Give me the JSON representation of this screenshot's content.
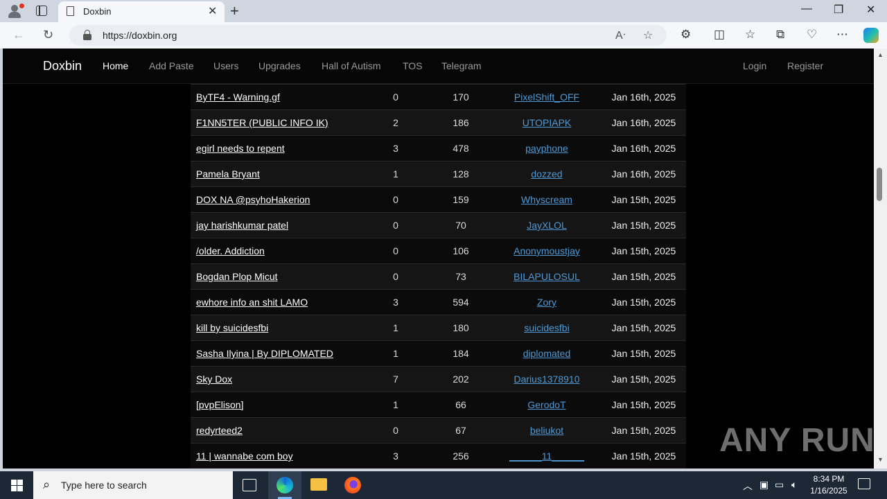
{
  "browser": {
    "tab_title": "Doxbin",
    "url": "https://doxbin.org"
  },
  "site": {
    "brand": "Doxbin",
    "nav": [
      "Home",
      "Add Paste",
      "Users",
      "Upgrades",
      "Hall of Autism",
      "TOS",
      "Telegram"
    ],
    "login": "Login",
    "register": "Register"
  },
  "pastes": [
    {
      "title": "ByTF4 - Warning.gf",
      "comments": "0",
      "views": "170",
      "user": "PixelShift_OFF",
      "date": "Jan 16th, 2025"
    },
    {
      "title": "F1NN5TER (PUBLIC INFO IK)",
      "comments": "2",
      "views": "186",
      "user": "UTOPIAPK",
      "date": "Jan 16th, 2025"
    },
    {
      "title": "egirl needs to repent",
      "comments": "3",
      "views": "478",
      "user": "payphone",
      "date": "Jan 16th, 2025"
    },
    {
      "title": "Pamela Bryant",
      "comments": "1",
      "views": "128",
      "user": "dozzed",
      "date": "Jan 16th, 2025"
    },
    {
      "title": "DOX NA @psyhoHakerion",
      "comments": "0",
      "views": "159",
      "user": "Whyscream",
      "date": "Jan 15th, 2025"
    },
    {
      "title": "jay harishkumar patel",
      "comments": "0",
      "views": "70",
      "user": "JayXLOL",
      "date": "Jan 15th, 2025"
    },
    {
      "title": "/older. Addiction",
      "comments": "0",
      "views": "106",
      "user": "Anonymoustjay",
      "date": "Jan 15th, 2025"
    },
    {
      "title": "Bogdan Plop Micut",
      "comments": "0",
      "views": "73",
      "user": "BILAPULOSUL",
      "date": "Jan 15th, 2025"
    },
    {
      "title": "ewhore info an shit LAMO",
      "comments": "3",
      "views": "594",
      "user": "Zory",
      "date": "Jan 15th, 2025"
    },
    {
      "title": "kill by suicidesfbi",
      "comments": "1",
      "views": "180",
      "user": "suicidesfbi",
      "date": "Jan 15th, 2025"
    },
    {
      "title": "Sasha Ilyina | By DIPLOMATED",
      "comments": "1",
      "views": "184",
      "user": "diplomated",
      "date": "Jan 15th, 2025"
    },
    {
      "title": "Sky Dox",
      "comments": "7",
      "views": "202",
      "user": "Darius1378910",
      "date": "Jan 15th, 2025"
    },
    {
      "title": "[pvpElison]",
      "comments": "1",
      "views": "66",
      "user": "GerodoT",
      "date": "Jan 15th, 2025"
    },
    {
      "title": "redyrteed2",
      "comments": "0",
      "views": "67",
      "user": "beliukot",
      "date": "Jan 15th, 2025"
    },
    {
      "title": "11 | wannabe com boy",
      "comments": "3",
      "views": "256",
      "user": "______11______",
      "date": "Jan 15th, 2025"
    }
  ],
  "watermark": "ANY RUN",
  "taskbar": {
    "search_placeholder": "Type here to search",
    "time": "8:34 PM",
    "date": "1/16/2025"
  }
}
